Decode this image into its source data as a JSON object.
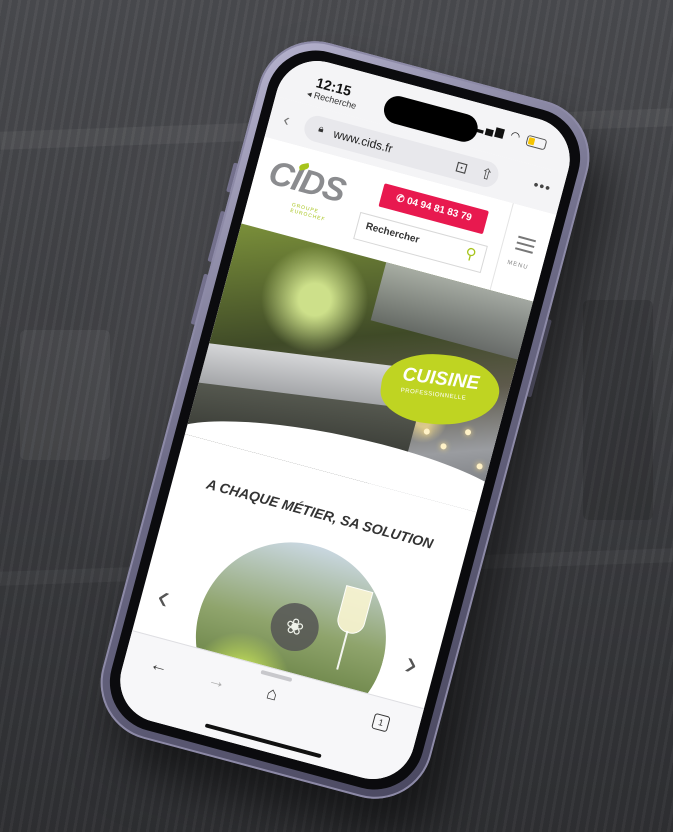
{
  "status_bar": {
    "time": "12:15",
    "back_app": "◂ Recherche"
  },
  "browser": {
    "url": "www.cids.fr"
  },
  "site": {
    "logo": "CIDS",
    "logo_sub": "GROUPE EUROCHEF",
    "phone": "04 94 81 83 79",
    "search_placeholder": "Rechercher",
    "menu_label": "MENU"
  },
  "hero": {
    "badge_title": "CUISINE",
    "badge_subtitle": "PROFESSIONNELLE"
  },
  "tagline": "A CHAQUE MÉTIER, SA SOLUTION",
  "toolbar": {
    "tabs_count": "1"
  },
  "colors": {
    "brand_green": "#a7c41c",
    "brand_pink": "#e8194f",
    "logo_grey": "#8b8c8f"
  }
}
